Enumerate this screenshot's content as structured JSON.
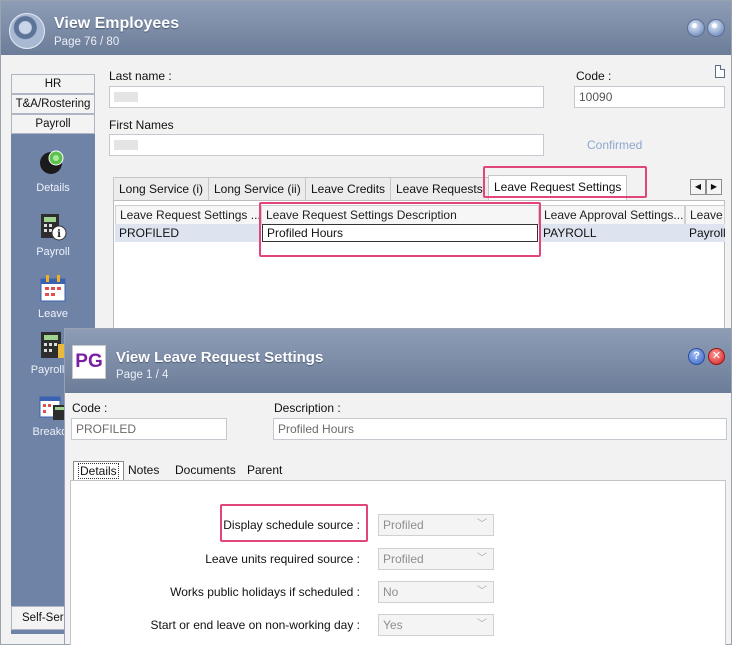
{
  "employees_window": {
    "title": "View Employees",
    "page": "Page 76 / 80",
    "sidebar": {
      "tabs": [
        "HR",
        "T&A/Rostering",
        "Payroll"
      ],
      "items": [
        "Details",
        "Payroll",
        "Leave",
        "Payroll N",
        "Breakdo"
      ],
      "bottom_tab": "Self-Ser"
    },
    "fields": {
      "last_name_label": "Last name :",
      "first_names_label": "First Names",
      "code_label": "Code :",
      "code_value": "10090",
      "status": "Confirmed"
    },
    "tabs": [
      "Long Service (i)",
      "Long Service (ii)",
      "Leave Credits",
      "Leave Requests",
      "Leave Request Settings"
    ],
    "grid": {
      "columns": [
        "Leave Request Settings ...",
        "Leave Request Settings Description",
        "Leave Approval Settings...",
        "Leave"
      ],
      "rows": [
        [
          "PROFILED",
          "Profiled Hours",
          "PAYROLL",
          "Payroll"
        ]
      ]
    }
  },
  "leave_window": {
    "logo": "PG",
    "title": "View Leave Request Settings",
    "page": "Page 1 / 4",
    "code_label": "Code :",
    "code_value": "PROFILED",
    "description_label": "Description :",
    "description_value": "Profiled Hours",
    "tabs": [
      "Details",
      "Notes",
      "Documents",
      "Parent"
    ],
    "form": [
      {
        "label": "Display schedule source :",
        "value": "Profiled"
      },
      {
        "label": "Leave units required source :",
        "value": "Profiled"
      },
      {
        "label": "Works public holidays if scheduled :",
        "value": "No"
      },
      {
        "label": "Start or end leave on non-working day :",
        "value": "Yes"
      }
    ]
  },
  "colors": {
    "titlebar": "#7b8ca9",
    "sidebar": "#6f83a6",
    "highlight": "#e0457b",
    "pg_logo": "#7a1fa2"
  }
}
